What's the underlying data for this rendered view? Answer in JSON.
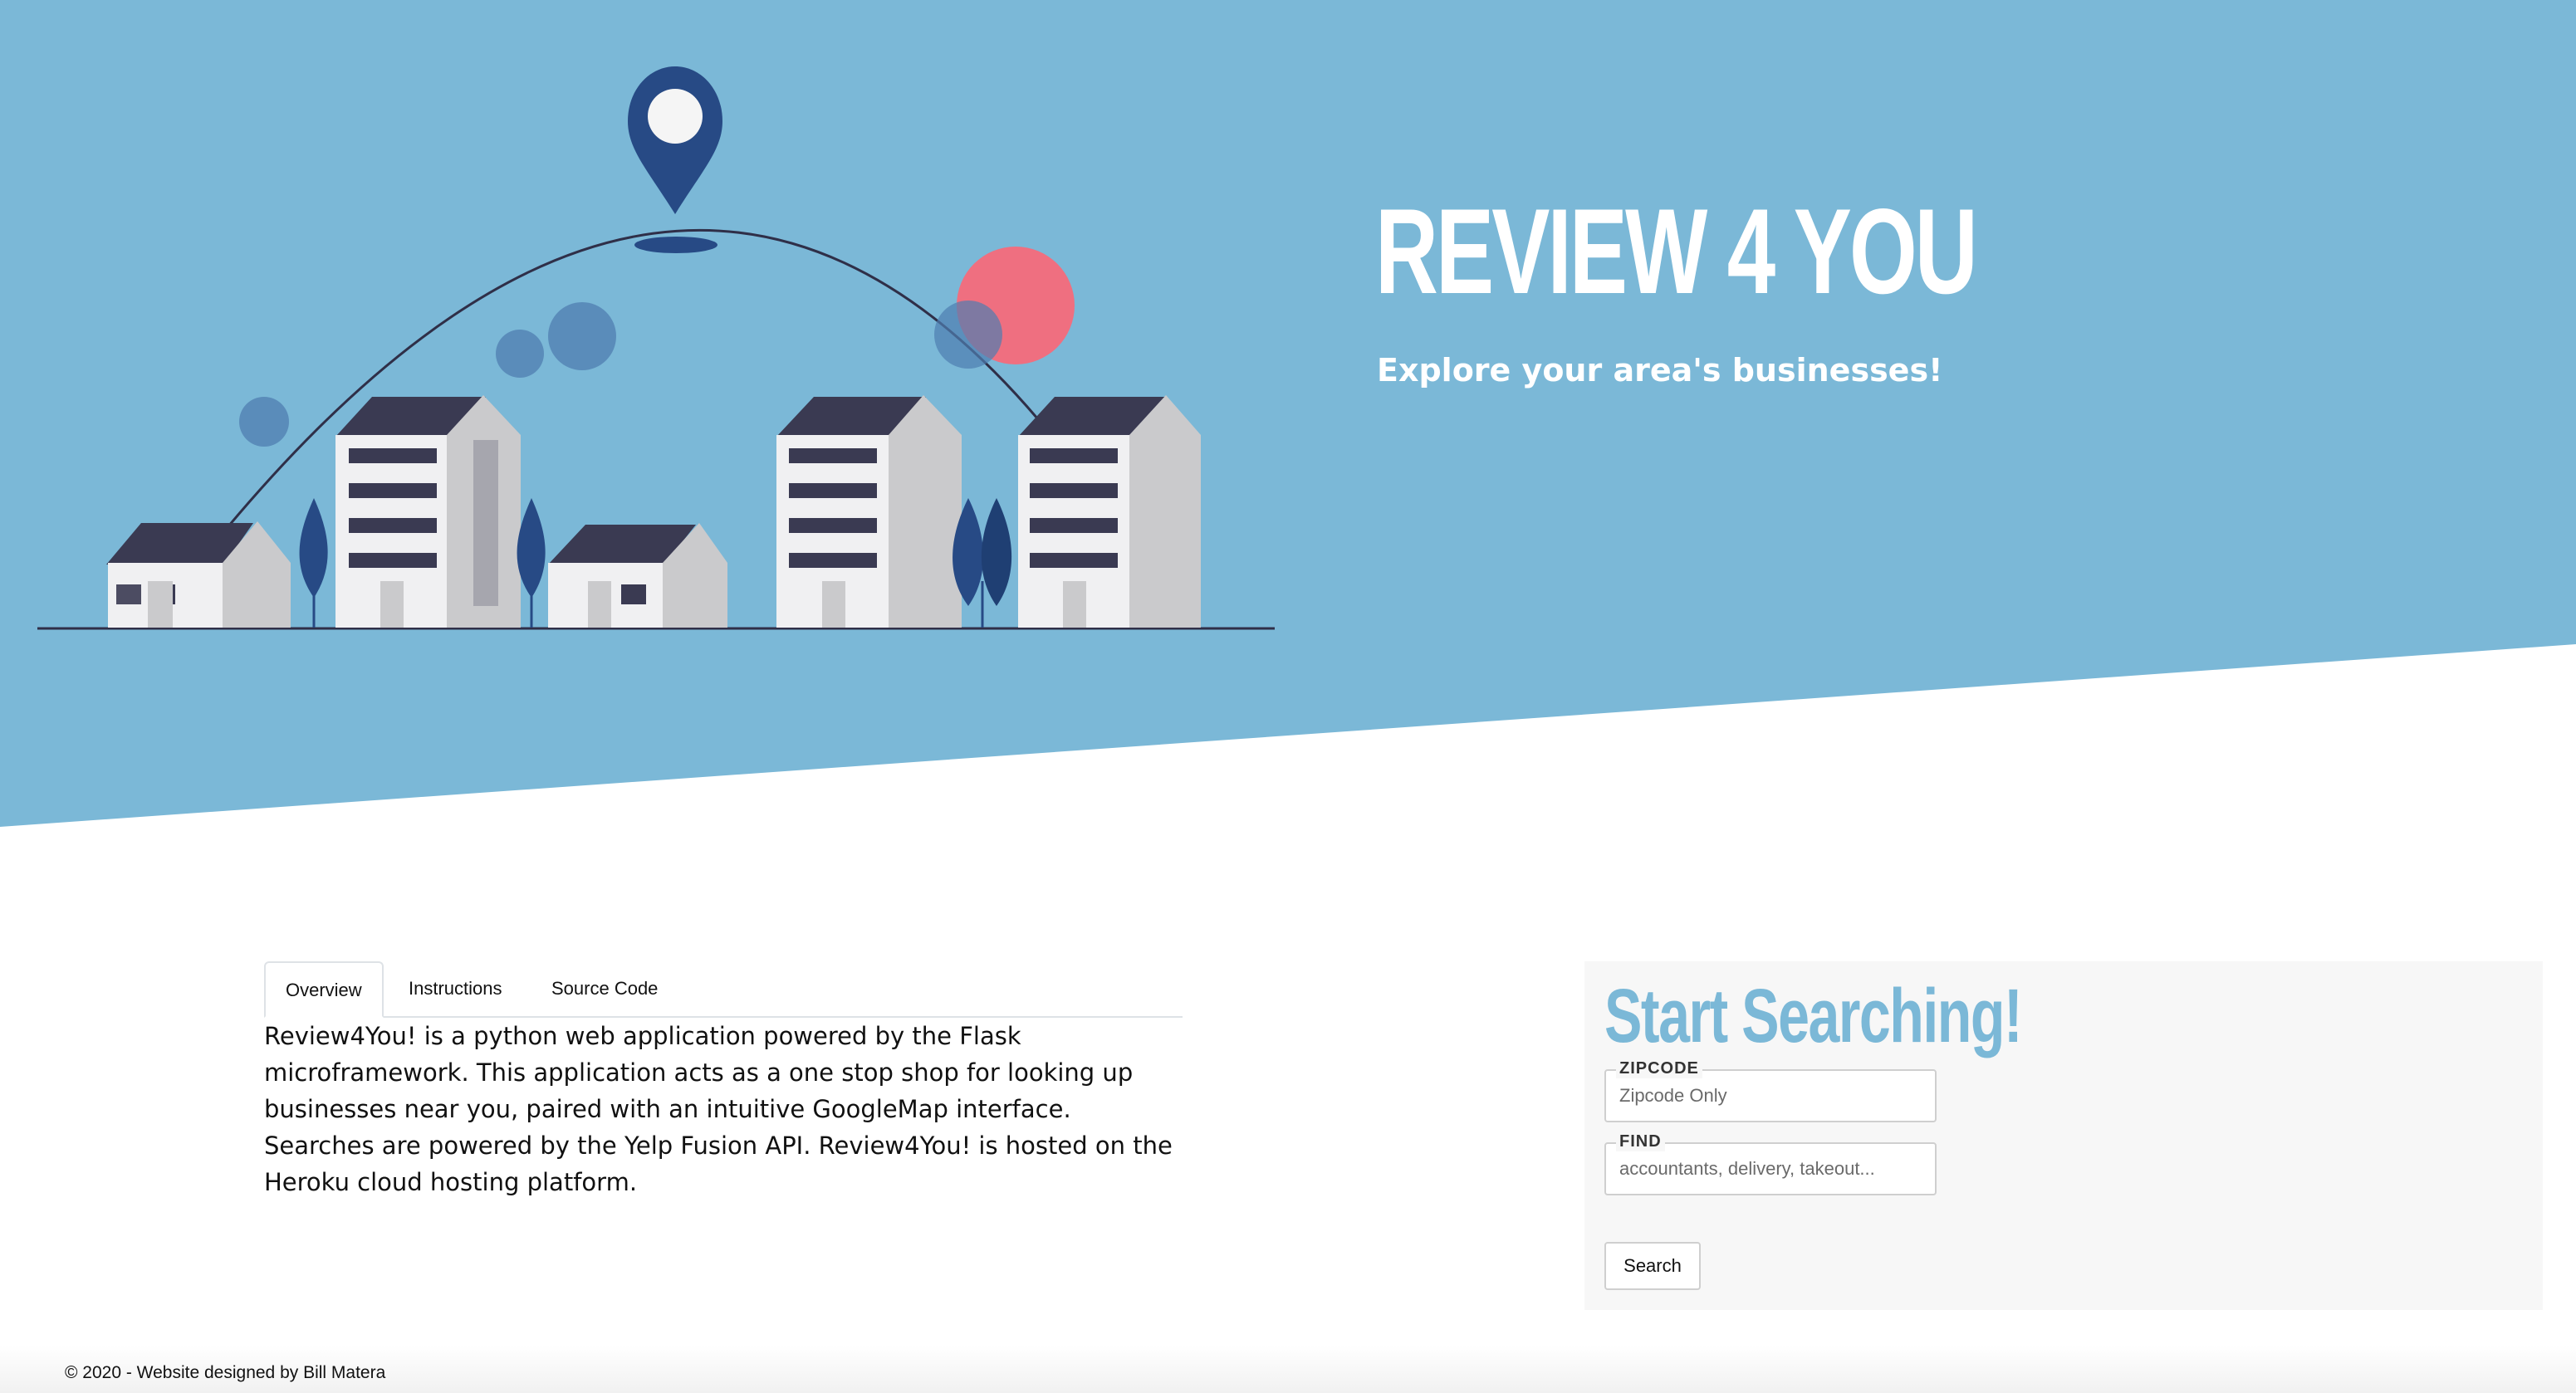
{
  "hero": {
    "title": "REVIEW 4 YOU",
    "subtitle": "Explore your area's businesses!",
    "background_color": "#7bb8d7",
    "illustration": "city-skyline-with-map-pin",
    "pin_color": "#274a85",
    "accent_circle_color": "#ef6f80"
  },
  "tabs": [
    {
      "label": "Overview",
      "active": true
    },
    {
      "label": "Instructions",
      "active": false
    },
    {
      "label": "Source Code",
      "active": false
    }
  ],
  "overview": {
    "t1": "Review4You! is a python web application powered by the ",
    "t2": "Flask microframework",
    "t3": ". This application acts as a one stop shop for looking up businesses near you, paired with an intuitive ",
    "t4": "GoogleMap interface",
    "t5": ". Searches are powered by the ",
    "t6": "Yelp Fusion API",
    "t7": ". Review4You! is hosted on the Heroku cloud hosting platform."
  },
  "search": {
    "title": "Start Searching!",
    "zipcode_label": "ZIPCODE",
    "zipcode_placeholder": "Zipcode Only",
    "find_label": "FIND",
    "find_placeholder": "accountants, delivery, takeout...",
    "button_label": "Search",
    "title_color": "#7bb8d7"
  },
  "footer": {
    "text": "© 2020 - Website designed by Bill Matera"
  }
}
